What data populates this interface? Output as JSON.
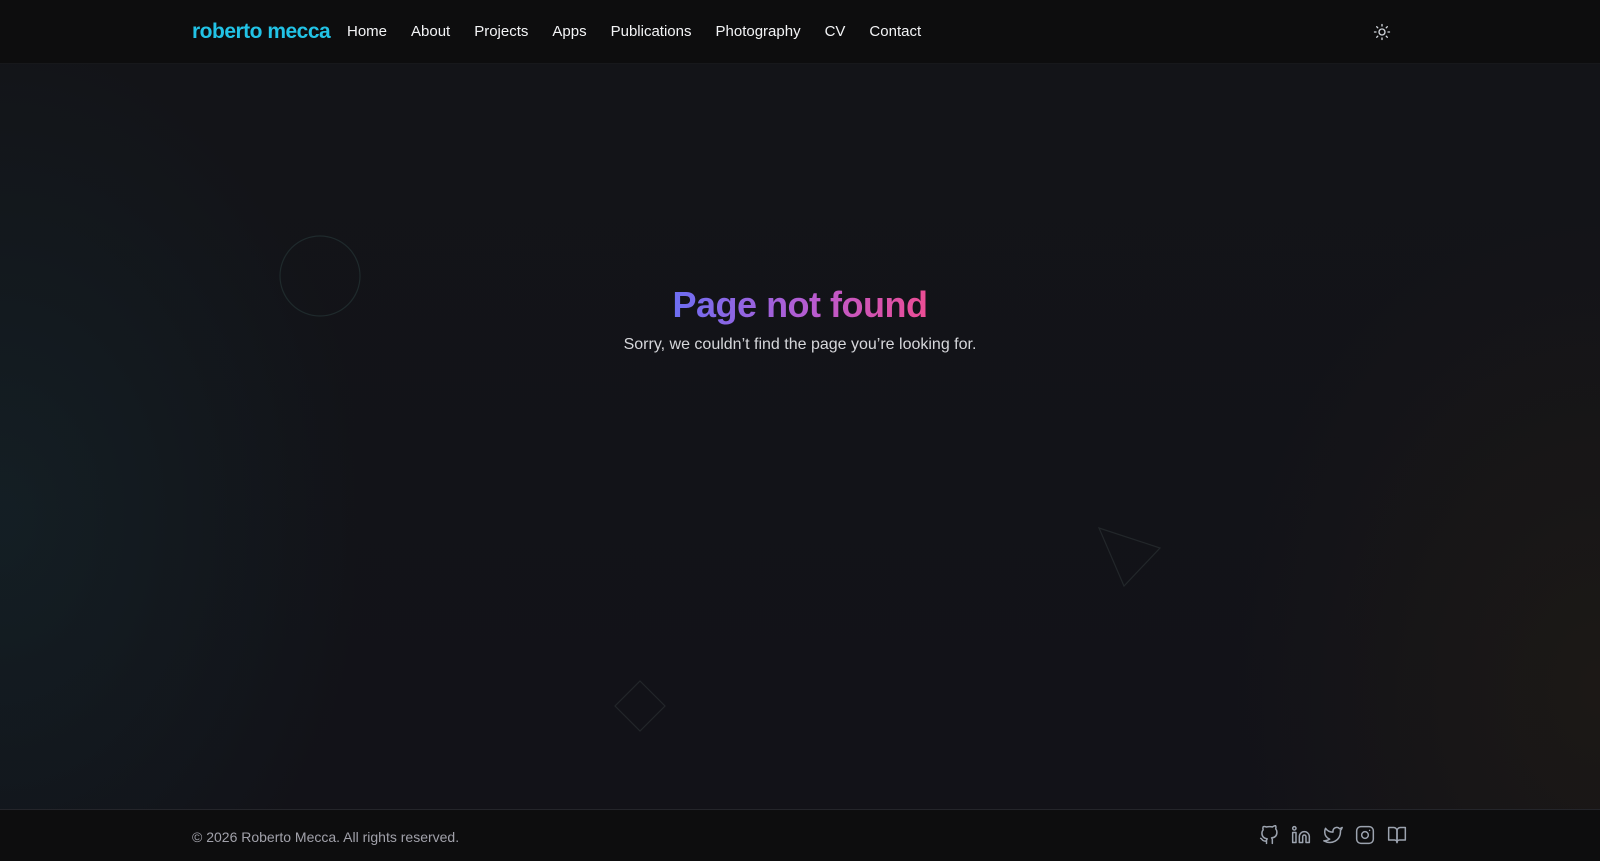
{
  "header": {
    "logo": "roberto mecca",
    "nav": [
      "Home",
      "About",
      "Projects",
      "Apps",
      "Publications",
      "Photography",
      "CV",
      "Contact"
    ],
    "theme_toggle_icon": "sun-icon"
  },
  "main": {
    "title": "Page not found",
    "subtitle": "Sorry, we couldn’t find the page you’re looking for."
  },
  "footer": {
    "copyright": "© 2026 Roberto Mecca. All rights reserved.",
    "social_icons": [
      "github-icon",
      "linkedin-icon",
      "twitter-icon",
      "instagram-icon",
      "book-open-icon"
    ]
  },
  "colors": {
    "logo": "#22c3e6",
    "title_gradient_start": "#6d6ef2",
    "title_gradient_end": "#ec4d94",
    "background": "#121216"
  }
}
